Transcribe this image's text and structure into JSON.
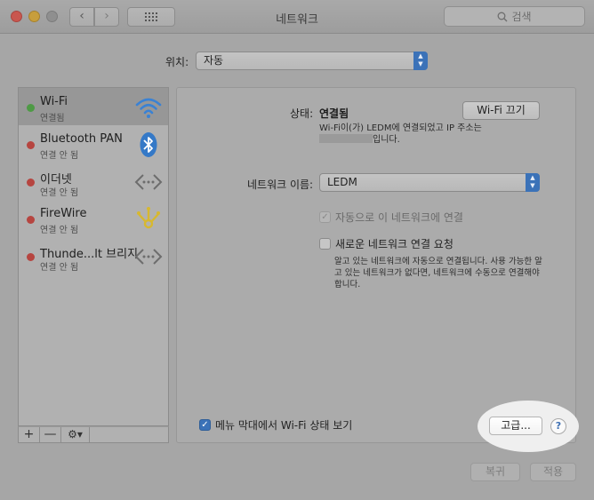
{
  "window": {
    "title": "네트워크",
    "search_placeholder": "검색",
    "back_glyph": "‹",
    "forward_glyph": "›"
  },
  "location": {
    "label": "위치:",
    "value": "자동"
  },
  "services": [
    {
      "name": "Wi-Fi",
      "status": "연결됨",
      "status_color": "green",
      "icon": "wifi-icon"
    },
    {
      "name": "Bluetooth PAN",
      "status": "연결 안 됨",
      "status_color": "red",
      "icon": "bluetooth-icon"
    },
    {
      "name": "이더넷",
      "status": "연결 안 됨",
      "status_color": "red",
      "icon": "ethernet-icon"
    },
    {
      "name": "FireWire",
      "status": "연결 안 됨",
      "status_color": "red",
      "icon": "firewire-icon"
    },
    {
      "name": "Thunde...lt 브리지",
      "status": "연결 안 됨",
      "status_color": "red",
      "icon": "thunderbolt-bridge-icon"
    }
  ],
  "sidebar_tools": {
    "add": "+",
    "remove": "—",
    "gear": "⚙▾"
  },
  "detail": {
    "status_label": "상태:",
    "status_value": "연결됨",
    "wifi_off_button": "Wi-Fi 끄기",
    "status_desc_line1": "Wi-Fi이(가) LEDM에 연결되었고 IP 주소는",
    "status_desc_line2": "입니다.",
    "network_name_label": "네트워크 이름:",
    "network_name_value": "LEDM",
    "auto_join_label": "자동으로 이 네트워크에 연결",
    "auto_join_checked": true,
    "ask_join_label": "새로운 네트워크 연결 요청",
    "ask_join_checked": false,
    "ask_join_desc": "알고 있는 네트워크에 자동으로 연결됩니다. 사용 가능한 알고 있는 네트워크가 없다면, 네트워크에 수동으로 연결해야 합니다.",
    "show_menu_label": "메뉴 막대에서 Wi-Fi 상태 보기",
    "show_menu_checked": true,
    "advanced_button": "고급...",
    "help_glyph": "?"
  },
  "footer": {
    "revert_button": "복귀",
    "apply_button": "적용"
  },
  "colors": {
    "accent": "#3b72b8",
    "connected": "#4e9a45",
    "disconnected": "#b64540"
  }
}
